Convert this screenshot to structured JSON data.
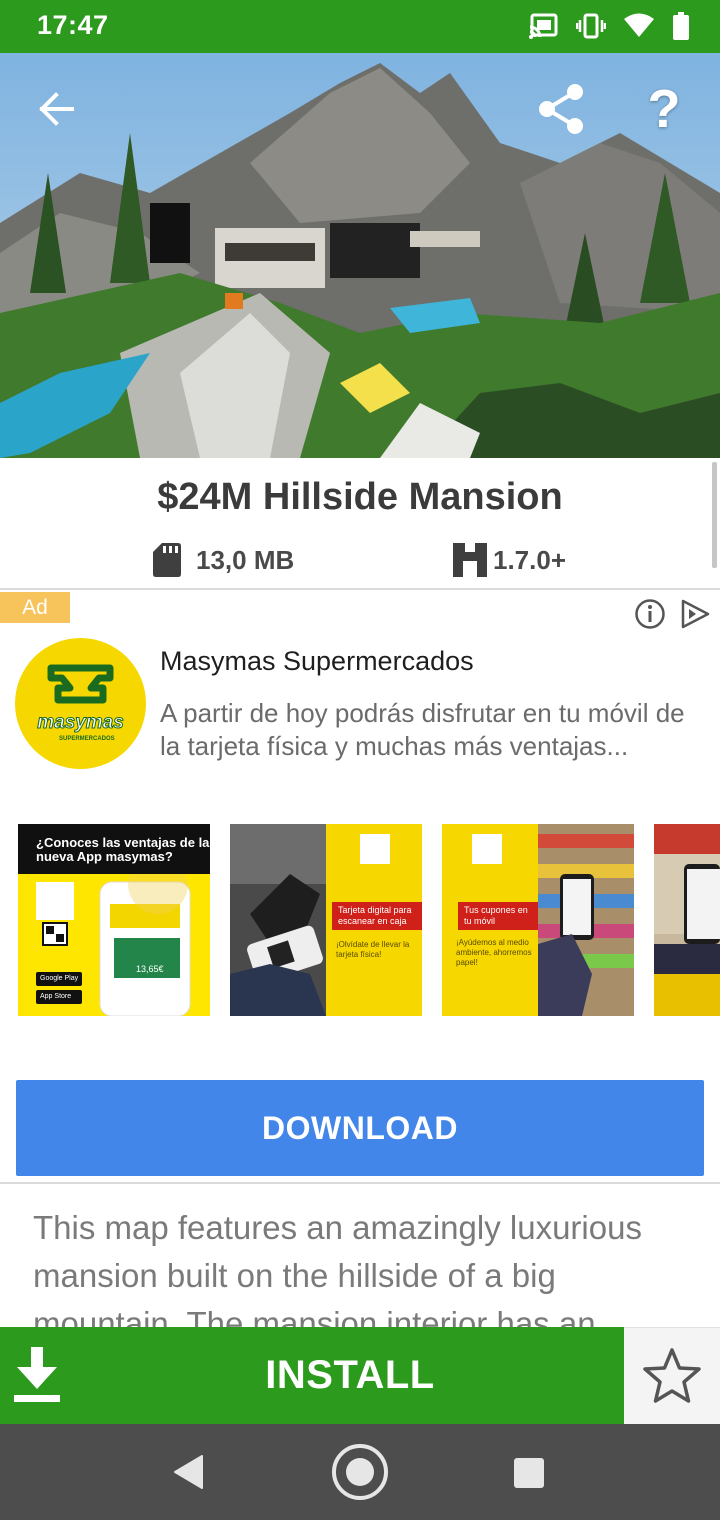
{
  "status_bar": {
    "time": "17:47",
    "icons": [
      "cast-icon",
      "vibrate-icon",
      "wifi-icon",
      "battery-icon"
    ]
  },
  "hero": {
    "image_description_name": "minecraft-mansion-screenshot",
    "back_icon": "arrow-back-icon",
    "share_icon": "share-icon",
    "help_label": "?"
  },
  "app": {
    "title": "$24M Hillside Mansion",
    "size": "13,0 MB",
    "version": "1.7.0+"
  },
  "ad": {
    "badge": "Ad",
    "advertiser": "Masymas Supermercados",
    "description": "A partir de hoy podrás disfrutar en tu móvil de la tarjeta física y muchas más ventajas...",
    "logo_text": "masymas",
    "logo_subtext": "SUPERMERCADOS",
    "images": {
      "img1_heading": "¿Conoces las ventajas de la nueva App masymas?",
      "img1_amount": "13,65€",
      "img1_store_google": "Google Play",
      "img1_store_apple": "App Store",
      "img2_label": "Tarjeta digital para escanear en caja",
      "img2_text": "¡Olvídate de llevar la tarjeta física!",
      "img3_label": "Tus cupones en tu móvil",
      "img3_text": "¡Ayúdemos al medio ambiente, ahorremos papel!"
    }
  },
  "download_button": "DOWNLOAD",
  "description": "This map features an amazingly luxurious mansion built on the hillside of a big mountain. The mansion interior has an",
  "install_button": "INSTALL",
  "colors": {
    "primary_green": "#2c9a1c",
    "download_blue": "#4286e9",
    "ad_badge": "#f7c45b",
    "nav_bar": "#4d4d4d"
  }
}
